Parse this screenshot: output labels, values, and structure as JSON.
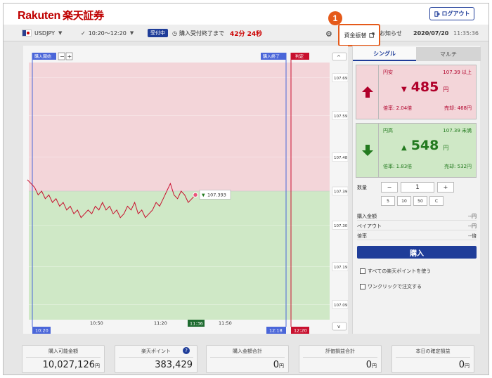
{
  "header": {
    "logo_brand": "Rakuten",
    "logo_jp": "楽天証券",
    "logout_label": "ログアウト",
    "logout_icon": "logout-icon"
  },
  "toolbar": {
    "pair": "USDJPY",
    "session": "10:20〜12:20",
    "status_badge": "受付中",
    "purchase_remaining_label": "購入受付終了まで",
    "countdown": "42分 24秒",
    "fund_transfer_label": "資金振替",
    "notice_label": "お知らせ",
    "date": "2020/07/20",
    "time": "11:35:36"
  },
  "step": {
    "number": "1"
  },
  "chart": {
    "purchase_start_label": "購入開始",
    "purchase_end_label": "購入終了",
    "judgement_label": "判定",
    "zoom_out": "−",
    "zoom_in": "+",
    "scroll_up": "^",
    "scroll_down": "v",
    "current_rate": "107.393",
    "y_ticks": [
      "107.69",
      "107.59",
      "107.48",
      "107.39",
      "107.30",
      "107.19",
      "107.09"
    ],
    "x_ticks": [
      "10:50",
      "11:20",
      "11:50"
    ],
    "start_time": "10:20",
    "current_time_marker": "11:36",
    "end_time": "12:18",
    "judgement_time": "12:20",
    "colors": {
      "up_zone": "#f3d5d9",
      "down_zone": "#cfe8c6",
      "line": "#c8102e",
      "vline": "#4a66d9"
    }
  },
  "chart_data": {
    "type": "line",
    "series": [
      {
        "values": [
          107.42,
          107.41,
          107.4,
          107.38,
          107.39,
          107.37,
          107.38,
          107.36,
          107.37,
          107.35,
          107.36,
          107.34,
          107.35,
          107.33,
          107.34,
          107.32,
          107.33,
          107.34,
          107.33,
          107.35,
          107.34,
          107.36,
          107.34,
          107.35,
          107.33,
          107.34,
          107.32,
          107.33,
          107.35,
          107.34,
          107.36,
          107.33,
          107.34,
          107.32,
          107.33,
          107.34,
          107.36,
          107.35,
          107.37,
          107.39,
          107.41,
          107.38,
          107.37,
          107.39,
          107.38,
          107.36,
          107.37,
          107.38
        ]
      }
    ],
    "ylim": [
      107.05,
      107.73
    ],
    "yticks": [
      107.69,
      107.59,
      107.48,
      107.39,
      107.3,
      107.19,
      107.09
    ],
    "xticks": [
      "10:50",
      "11:20",
      "11:50"
    ],
    "threshold": 107.39
  },
  "order": {
    "tab_single": "シングル",
    "tab_multi": "マルチ",
    "high": {
      "label": "円安",
      "rate_condition": "107.39 以上",
      "price": "485",
      "unit": "円",
      "multiplier": "倍率: 2.04倍",
      "return": "売却: 468円"
    },
    "low": {
      "label": "円高",
      "rate_condition": "107.39 未満",
      "price": "548",
      "unit": "円",
      "multiplier": "倍率: 1.83倍",
      "return": "売却: 532円"
    },
    "quantity_label": "数量",
    "quantity": "1",
    "minus": "−",
    "plus": "+",
    "presets": [
      "5",
      "10",
      "50",
      "C"
    ],
    "purchase_amount_label": "購入金額",
    "purchase_amount_value": "--円",
    "payout_label": "ペイアウト",
    "payout_value": "--円",
    "multiplier_label": "倍率",
    "multiplier_value": "--倍",
    "buy_label": "購入",
    "use_points_label": "すべての楽天ポイントを使う",
    "one_click_label": "ワンクリックで注文する"
  },
  "summary": [
    {
      "label": "購入可能金額",
      "value": "10,027,126",
      "unit": "円"
    },
    {
      "label": "楽天ポイント",
      "value": "383,429",
      "unit": ""
    },
    {
      "label": "購入金額合計",
      "value": "0",
      "unit": "円"
    },
    {
      "label": "評価損益合計",
      "value": "0",
      "unit": "円"
    },
    {
      "label": "本日の確定損益",
      "value": "0",
      "unit": "円"
    }
  ]
}
